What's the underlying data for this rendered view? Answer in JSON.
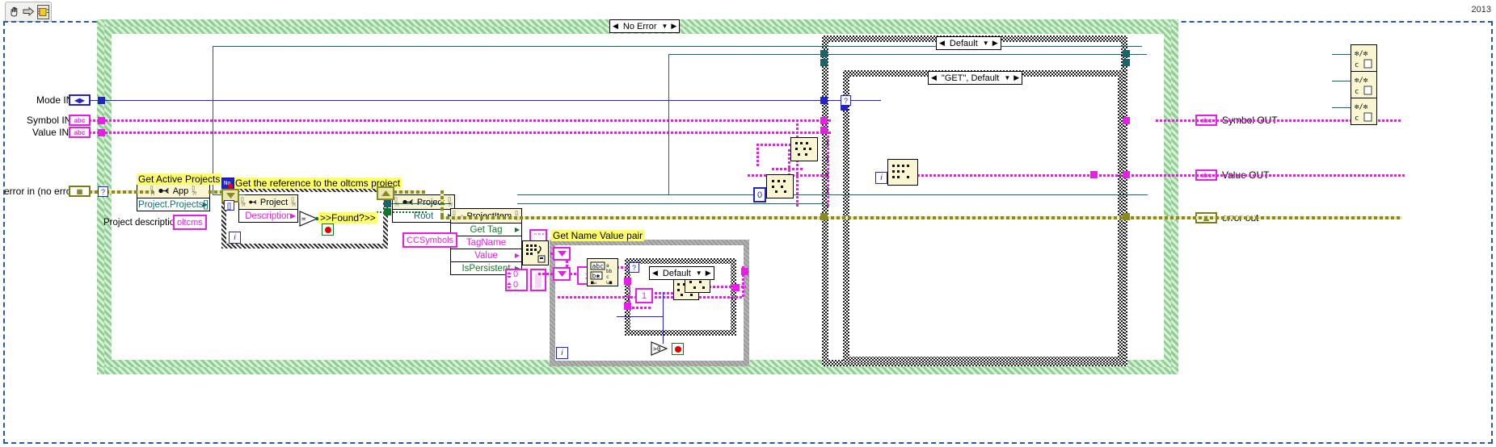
{
  "window": {
    "version_label": "2013",
    "toolbar": {
      "buttons": [
        {
          "name": "hand-tool",
          "glyph": "✋"
        },
        {
          "name": "run-arrow",
          "glyph": "⇨"
        },
        {
          "name": "vi-icon",
          "glyph": "▤"
        }
      ]
    }
  },
  "terminals": {
    "inputs": [
      {
        "label": "Mode IN",
        "type": "enum",
        "glyph": "◀▶",
        "color": "#2323c8"
      },
      {
        "label": "Symbol IN",
        "type": "string",
        "glyph": "abc",
        "color": "#e81ee8"
      },
      {
        "label": "Value IN",
        "type": "string",
        "glyph": "abc",
        "color": "#e81ee8"
      },
      {
        "label": "error in (no error)",
        "type": "errorcluster",
        "glyph": "⛓",
        "color": "#7c7c18"
      }
    ],
    "outputs": [
      {
        "label": "Symbol OUT",
        "type": "string",
        "glyph": "abc",
        "color": "#e81ee8"
      },
      {
        "label": "Value OUT",
        "type": "string",
        "glyph": "abc",
        "color": "#e81ee8"
      },
      {
        "label": "error out",
        "type": "errorcluster",
        "glyph": "⛓",
        "color": "#7c7c18"
      }
    ]
  },
  "structures": {
    "while_loop": {
      "name": "while-loop"
    },
    "outer_case": {
      "selector": "No Error"
    },
    "right_case": {
      "selector": "Default"
    },
    "inner_case": {
      "selector": "\"GET\", Default"
    },
    "nested_case": {
      "selector": "Default"
    }
  },
  "comments": [
    {
      "name": "get-active-projects-comment",
      "text": "Get Active Projects"
    },
    {
      "name": "get-reference-comment",
      "text": "Get the reference to the oltcms project"
    },
    {
      "name": "found-comment",
      "text": ">>Found?>>"
    },
    {
      "name": "get-name-value-pair-comment",
      "text": "Get Name Value pair"
    }
  ],
  "nodes": {
    "app_property": {
      "header": "App",
      "rows": [
        {
          "label": "Project.Projects[]",
          "color": "teal",
          "pin": "right"
        }
      ]
    },
    "project_desc_property": {
      "header": "Project",
      "rows": [
        {
          "label": "Description",
          "color": "mag",
          "pin": "right"
        }
      ]
    },
    "project_root_property": {
      "header": "Project",
      "rows": [
        {
          "label": "Root",
          "color": "teal",
          "pin": "right"
        }
      ]
    },
    "projectitem_property": {
      "header": "ProjectItem",
      "rows": [
        {
          "label": "Get Tag",
          "color": "grn",
          "pin": "right"
        },
        {
          "label": "TagName",
          "color": "mag",
          "pin": "left"
        },
        {
          "label": "Value",
          "color": "mag",
          "pin": "right"
        },
        {
          "label": "IsPersistent",
          "color": "grn",
          "pin": "right"
        }
      ]
    }
  },
  "labels": {
    "project_description_label": "Project description",
    "oltcms_constant": "oltcms",
    "ccsymbols_constant": "CCSymbols",
    "zero_a": "0",
    "zero_b": "0"
  },
  "icons": {
    "string_const": "“”",
    "search_1d_array": "search-1d-array-icon",
    "match_pattern": "match-pattern-icon",
    "format_into_string": "format-into-string-icon",
    "scan_from_string": "scan-from-string-icon",
    "string_to_path": "string-to-path-icon",
    "case_default": "case-default-icon"
  },
  "colors": {
    "wire_string": "#e81ee8",
    "wire_error": "#8a8a20",
    "wire_refnum": "#17656b",
    "wire_numeric": "#2323c8",
    "comment_bg": "#ffff66",
    "node_bg": "#faf6d2",
    "loop_green": "#8fcf94"
  }
}
